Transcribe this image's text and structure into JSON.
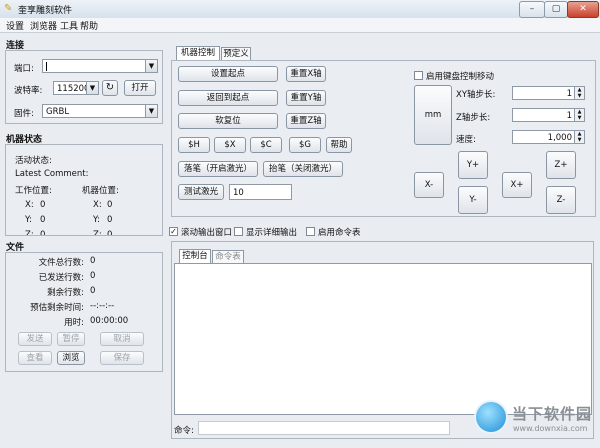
{
  "window": {
    "title": "奎享雕刻软件",
    "minimize": "–",
    "maximize": "▢",
    "close": "✕"
  },
  "menu": [
    "设置",
    "浏览器",
    "工具",
    "帮助"
  ],
  "connection": {
    "title": "连接",
    "port_label": "端口:",
    "port_value": "",
    "baud_label": "波特率:",
    "baud_value": "115200",
    "open_button": "打开",
    "firmware_label": "固件:",
    "firmware_value": "GRBL"
  },
  "machine_state": {
    "title": "机器状态",
    "activity_label": "活动状态:",
    "latest_comment_label": "Latest Comment:",
    "work_pos_label": "工作位置:",
    "machine_pos_label": "机器位置:",
    "x_label": "X:",
    "x_work": "0",
    "x_machine": "0",
    "y_label": "Y:",
    "y_work": "0",
    "y_machine": "0",
    "z_label": "Z:",
    "z_work": "0",
    "z_machine": "0"
  },
  "file": {
    "title": "文件",
    "total_rows_label": "文件总行数:",
    "total_rows": "0",
    "sent_rows_label": "已发送行数:",
    "sent_rows": "0",
    "remaining_rows_label": "剩余行数:",
    "remaining_rows": "0",
    "estimated_label": "预估剩余时间:",
    "estimated": "--:--:--",
    "duration_label": "用时:",
    "duration": "00:00:00",
    "send_button": "发送",
    "pause_button": "暂停",
    "cancel_button": "取消",
    "view_button": "查看",
    "browse_button": "浏览",
    "save_button": "保存"
  },
  "control_tabs": [
    "机器控制",
    "预定义"
  ],
  "machine_control": {
    "set_origin": "设置起点",
    "reset_x": "重置X轴",
    "return_origin": "返回到起点",
    "reset_y": "重置Y轴",
    "soft_reset": "软复位",
    "reset_z": "重置Z轴",
    "cmd_h": "$H",
    "cmd_x": "$X",
    "cmd_c": "$C",
    "cmd_g": "$G",
    "help": "帮助",
    "pen_down": "落笔（开启激光）",
    "pen_up": "抬笔（关闭激光）",
    "test_laser": "测试激光",
    "laser_value": "10"
  },
  "jog": {
    "keyboard_label": "启用键盘控制移动",
    "unit": "mm",
    "xy_step_label": "XY轴步长:",
    "xy_step": "1",
    "z_step_label": "Z轴步长:",
    "z_step": "1",
    "speed_label": "速度:",
    "speed": "1,000",
    "x_minus": "X-",
    "x_plus": "X+",
    "y_plus": "Y+",
    "y_minus": "Y-",
    "z_plus": "Z+",
    "z_minus": "Z-"
  },
  "options": {
    "scroll_output": "滚动输出窗口",
    "verbose_output": "显示详细输出",
    "enable_cmd_table": "启用命令表"
  },
  "console_tabs": [
    "控制台",
    "命令表"
  ],
  "console": {
    "command_label": "命令:",
    "command_value": ""
  },
  "watermark": {
    "brand": "当下软件园",
    "url": "www.downxia.com"
  }
}
